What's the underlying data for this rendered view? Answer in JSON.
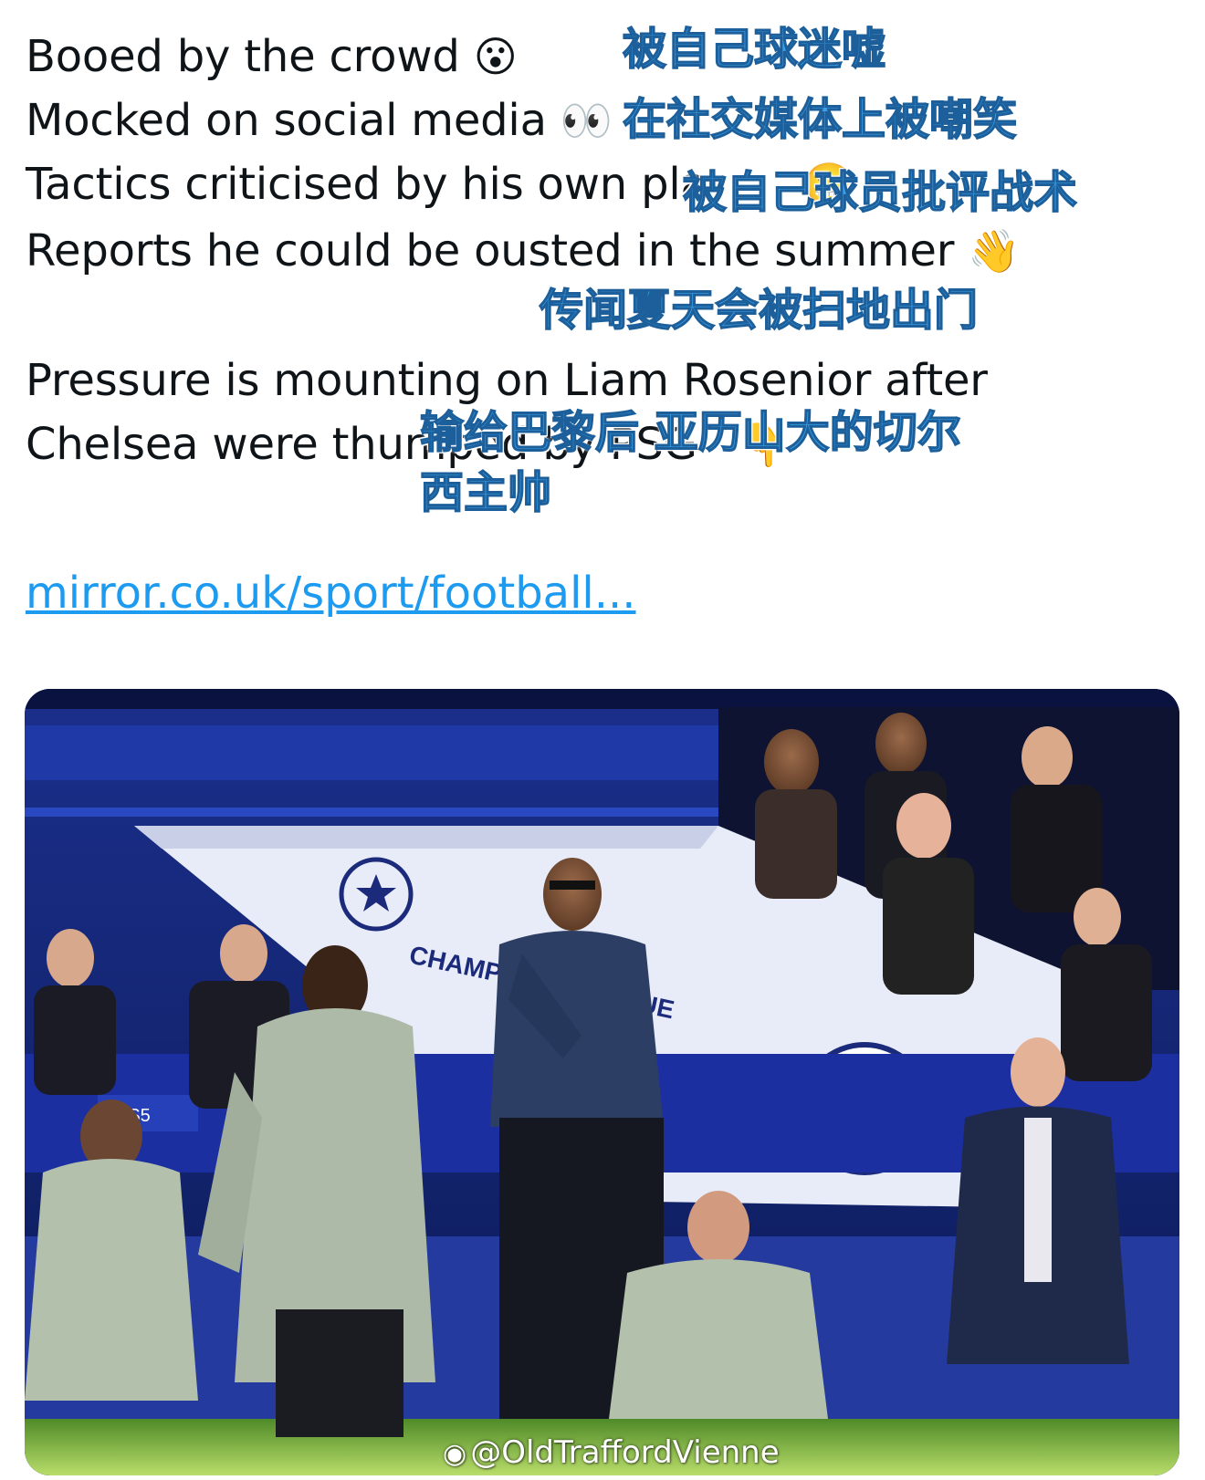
{
  "tweet": {
    "lines": [
      {
        "text": "Booed by the crowd",
        "emoji": "😮"
      },
      {
        "text": "Mocked on social media",
        "emoji": "👀"
      },
      {
        "text": "Tactics criticised by his own pla",
        "emoji": "😬"
      },
      {
        "text": "Reports he could be ousted in the summer",
        "emoji": "👋"
      },
      {
        "text": "Pressure is mounting on Liam Rosenior after",
        "emoji": ""
      },
      {
        "text": "Chelsea were thumped by PSG",
        "emoji": "👇"
      }
    ],
    "link": "mirror.co.uk/sport/football..."
  },
  "overlays": [
    "被自己球迷嘘",
    "在社交媒体上被嘲笑",
    "被自己球员批评战术",
    "传闻夏天会被扫地出门",
    "输给巴黎后 亚历山大的切尔",
    "西主帅"
  ],
  "photo": {
    "board_text": "CHAMPIONS LEAGUE",
    "ps5_text": "PS5",
    "watermark": "@OldTraffordVienne",
    "weibo_icon": "weibo-logo-icon"
  }
}
